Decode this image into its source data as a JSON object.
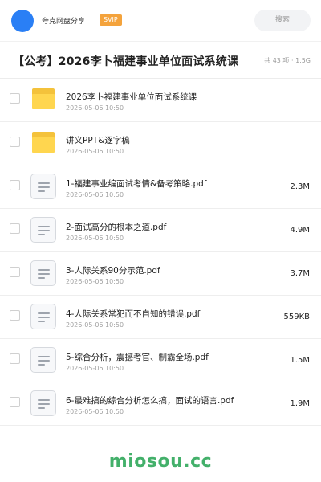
{
  "header": {
    "brand": "夸克网盘分享",
    "badge": "SVIP",
    "search_placeholder": "搜索"
  },
  "share": {
    "title": "【公考】2026李卜福建事业单位面试系统课",
    "meta": "共 43 项 · 1.5G"
  },
  "files": [
    {
      "name": "2026李卜福建事业单位面试系统课",
      "date": "2026-05-06 10:50",
      "size": "",
      "type": "folder"
    },
    {
      "name": "讲义PPT&逐字稿",
      "date": "2026-05-06 10:50",
      "size": "",
      "type": "folder"
    },
    {
      "name": "1-福建事业编面试考情&备考策略.pdf",
      "date": "2026-05-06 10:50",
      "size": "2.3M",
      "type": "document"
    },
    {
      "name": "2-面试高分的根本之道.pdf",
      "date": "2026-05-06 10:50",
      "size": "4.9M",
      "type": "document"
    },
    {
      "name": "3-人际关系90分示范.pdf",
      "date": "2026-05-06 10:50",
      "size": "3.7M",
      "type": "document"
    },
    {
      "name": "4-人际关系常犯而不自知的错误.pdf",
      "date": "2026-05-06 10:50",
      "size": "559KB",
      "type": "document"
    },
    {
      "name": "5-综合分析，震撼考官、制霸全场.pdf",
      "date": "2026-05-06 10:50",
      "size": "1.5M",
      "type": "document"
    },
    {
      "name": "6-最难搞的综合分析怎么搞，面试的语言.pdf",
      "date": "2026-05-06 10:50",
      "size": "1.9M",
      "type": "document"
    }
  ],
  "watermark": "miosou.cc",
  "colors": {
    "avatar": "#2a7ff5",
    "badge": "#f4a33c",
    "folder": "#ffd64f",
    "watermark": "#43b06a"
  }
}
